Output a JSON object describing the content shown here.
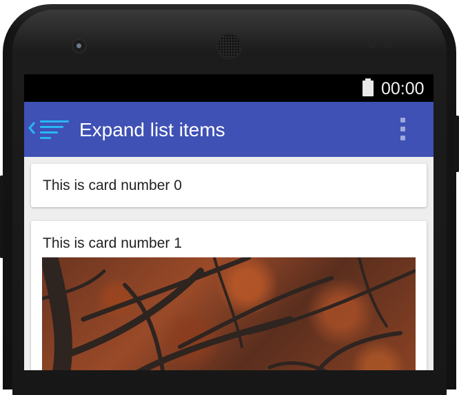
{
  "status_bar": {
    "time": "00:00"
  },
  "app_bar": {
    "title": "Expand list items"
  },
  "cards": [
    {
      "text": "This is card number 0"
    },
    {
      "text": "This is card number 1"
    }
  ],
  "icons": {
    "back": "chevron-left-icon",
    "navigation": "sort-lines-icon",
    "overflow": "more-vert-icon",
    "battery": "battery-icon"
  },
  "colors": {
    "app_bar": "#3f51b5",
    "status_bar": "#000000",
    "list_icon": "#29b6f6",
    "overflow_icon": "#9fa8da",
    "background": "#eeeeee"
  }
}
